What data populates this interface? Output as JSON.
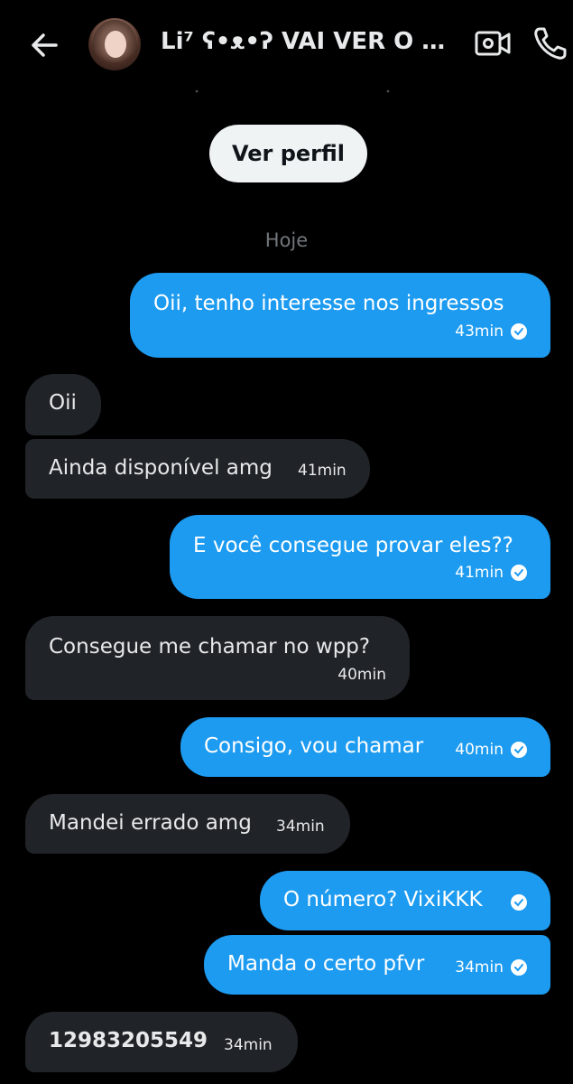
{
  "header": {
    "contact_name": "Li⁷ ʕ•ᴥ•ʔ VAI VER O …",
    "back_icon": "arrow-left-icon",
    "video_icon": "video-camera-icon",
    "call_icon": "phone-icon"
  },
  "profile_button": {
    "label": "Ver perfil"
  },
  "date_separator": "Hoje",
  "messages": [
    {
      "direction": "out",
      "text": "Oii, tenho interesse nos ingressos",
      "time": "43min",
      "read": true
    },
    {
      "direction": "in",
      "text": "Oii",
      "time": ""
    },
    {
      "direction": "in",
      "text": "Ainda disponível amg",
      "time": "41min"
    },
    {
      "direction": "out",
      "text": "E você consegue provar eles??",
      "time": "41min",
      "read": true
    },
    {
      "direction": "in",
      "text": "Consegue me chamar no wpp?",
      "time": "40min"
    },
    {
      "direction": "out",
      "text": "Consigo, vou chamar",
      "time": "40min",
      "read": true
    },
    {
      "direction": "in",
      "text": "Mandei errado amg",
      "time": "34min"
    },
    {
      "direction": "out",
      "text": "O número? VixiKKK",
      "time": "",
      "read": true
    },
    {
      "direction": "out",
      "text": "Manda o certo pfvr",
      "time": "34min",
      "read": true
    },
    {
      "direction": "in",
      "text": "12983205549",
      "time": "34min"
    }
  ],
  "colors": {
    "background": "#000000",
    "outgoing_bubble": "#1d9bf0",
    "incoming_bubble": "#202327",
    "profile_button": "#eff3f4",
    "muted_text": "#71767b"
  }
}
